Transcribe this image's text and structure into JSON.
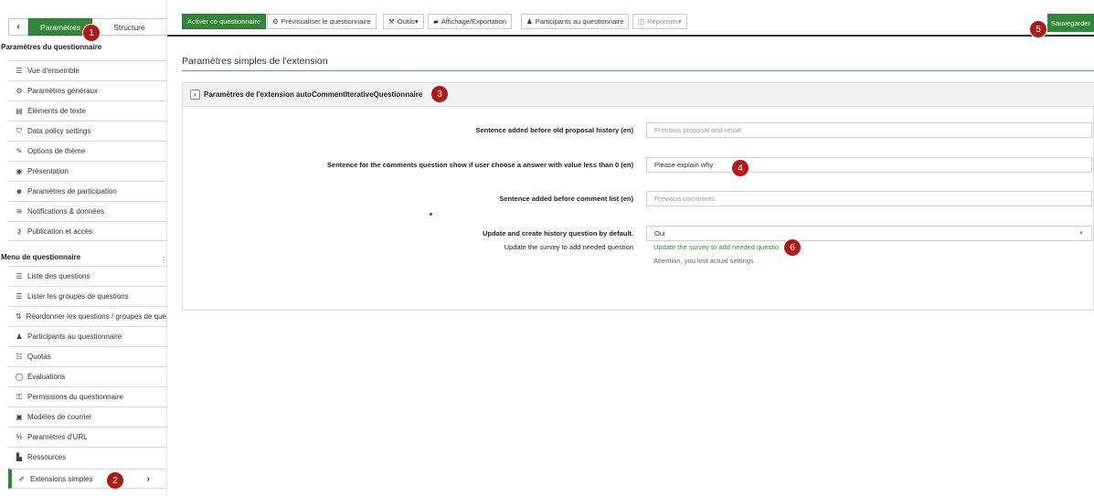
{
  "sidebar": {
    "tabs": {
      "settings": "Paramètres",
      "structure": "Structure"
    },
    "section_settings": "Paramètres du questionnaire",
    "settings_items": [
      {
        "icon": "list-icon",
        "glyph": "☰",
        "label": "Vue d'ensemble"
      },
      {
        "icon": "cogs-icon",
        "glyph": "⚙",
        "label": "Paramètres généraux"
      },
      {
        "icon": "file-text-icon",
        "glyph": "▤",
        "label": "Éléments de texte"
      },
      {
        "icon": "shield-icon",
        "glyph": "⛉",
        "label": "Data policy settings"
      },
      {
        "icon": "paint-brush-icon",
        "glyph": "✎",
        "label": "Options de thème"
      },
      {
        "icon": "eye-slash-icon",
        "glyph": "◉",
        "label": "Présentation"
      },
      {
        "icon": "users-icon",
        "glyph": "☻",
        "label": "Paramètres de participation"
      },
      {
        "icon": "rss-icon",
        "glyph": "≋",
        "label": "Notifications & données"
      },
      {
        "icon": "key-icon",
        "glyph": "⚷",
        "label": "Publication et accès"
      }
    ],
    "section_menu": "Menu de questionnaire",
    "menu_items": [
      {
        "icon": "list-icon",
        "glyph": "☰",
        "label": "Liste des questions"
      },
      {
        "icon": "list-icon",
        "glyph": "☰",
        "label": "Lister les groupes de questions"
      },
      {
        "icon": "sort-icon",
        "glyph": "⇅",
        "label": "Réordonner les questions / groupes de que"
      },
      {
        "icon": "user-icon",
        "glyph": "♟",
        "label": "Participants au questionnaire"
      },
      {
        "icon": "tasks-icon",
        "glyph": "☷",
        "label": "Quotas"
      },
      {
        "icon": "comment-icon",
        "glyph": "◯",
        "label": "Évaluations"
      },
      {
        "icon": "lock-icon",
        "glyph": "⚿",
        "label": "Permissions du questionnaire"
      },
      {
        "icon": "envelope-icon",
        "glyph": "▣",
        "label": "Modèles de courriel"
      },
      {
        "icon": "link-icon",
        "glyph": "%",
        "label": "Paramètres d'URL"
      },
      {
        "icon": "file-icon",
        "glyph": "▙",
        "label": "Ressources"
      },
      {
        "icon": "plug-icon",
        "glyph": "✐",
        "label": "Extensions simples"
      }
    ]
  },
  "toolbar": {
    "activate": "Activer ce questionnaire",
    "preview": "Prévisualiser le questionnaire",
    "tools": "Outils",
    "display_export": "Affichage/Exportation",
    "participants": "Participants au questionnaire",
    "responses": "Réponses",
    "save": "Sauvegarder"
  },
  "main": {
    "page_title": "Paramètres simples de l'extension",
    "panel_title": "Paramètres de l'extension autoCommentIterativeQuestionnaire",
    "rows": [
      {
        "label": "Sentence added before old proposal history (en)",
        "placeholder": "Previous proposal and result",
        "value": ""
      },
      {
        "label": "Sentence for the comments question show if user choose a answer with value less than 0 (en)",
        "placeholder": "",
        "value": "Please explain why"
      },
      {
        "label": "Sentence added before comment list (en)",
        "placeholder": "Previous comments.",
        "value": ""
      },
      {
        "label": "Update and create history question by default.",
        "placeholder": "",
        "value": "Oui"
      }
    ],
    "update_label": "Update the survey to add needed question",
    "update_link": "Update the survey to add needed questio",
    "update_note": "Attention, you lost actual settings"
  },
  "badges": [
    "1",
    "2",
    "3",
    "4",
    "5",
    "6"
  ],
  "colors": {
    "primary_green": "#328637",
    "badge_red": "#b01818"
  }
}
